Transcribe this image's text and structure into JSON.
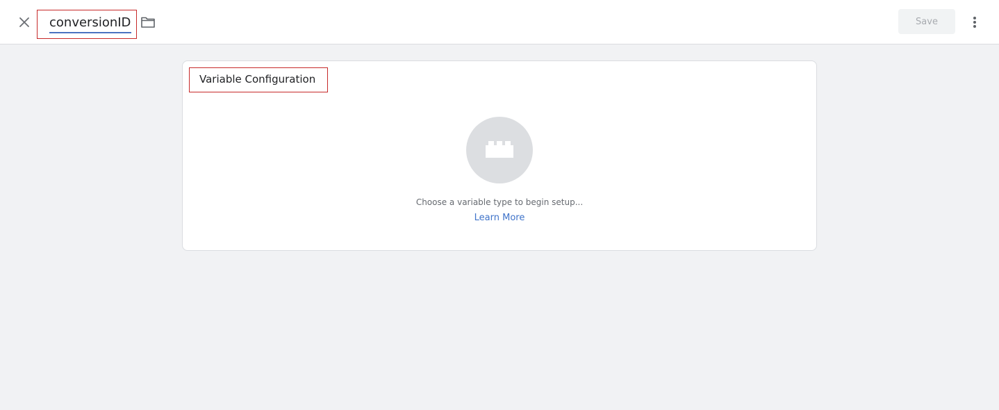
{
  "header": {
    "close_icon": "close-icon",
    "variable_name": "conversionID",
    "folder_icon": "folder-icon",
    "save_label": "Save",
    "more_icon": "more-vert-icon"
  },
  "config_card": {
    "title": "Variable Configuration",
    "type_icon": "lego-brick-icon",
    "hint": "Choose a variable type to begin setup...",
    "learn_more": "Learn More"
  },
  "colors": {
    "accent": "#4a72c0",
    "link": "#3f73c9",
    "highlight_border": "#c62828",
    "background": "#f1f2f4"
  }
}
